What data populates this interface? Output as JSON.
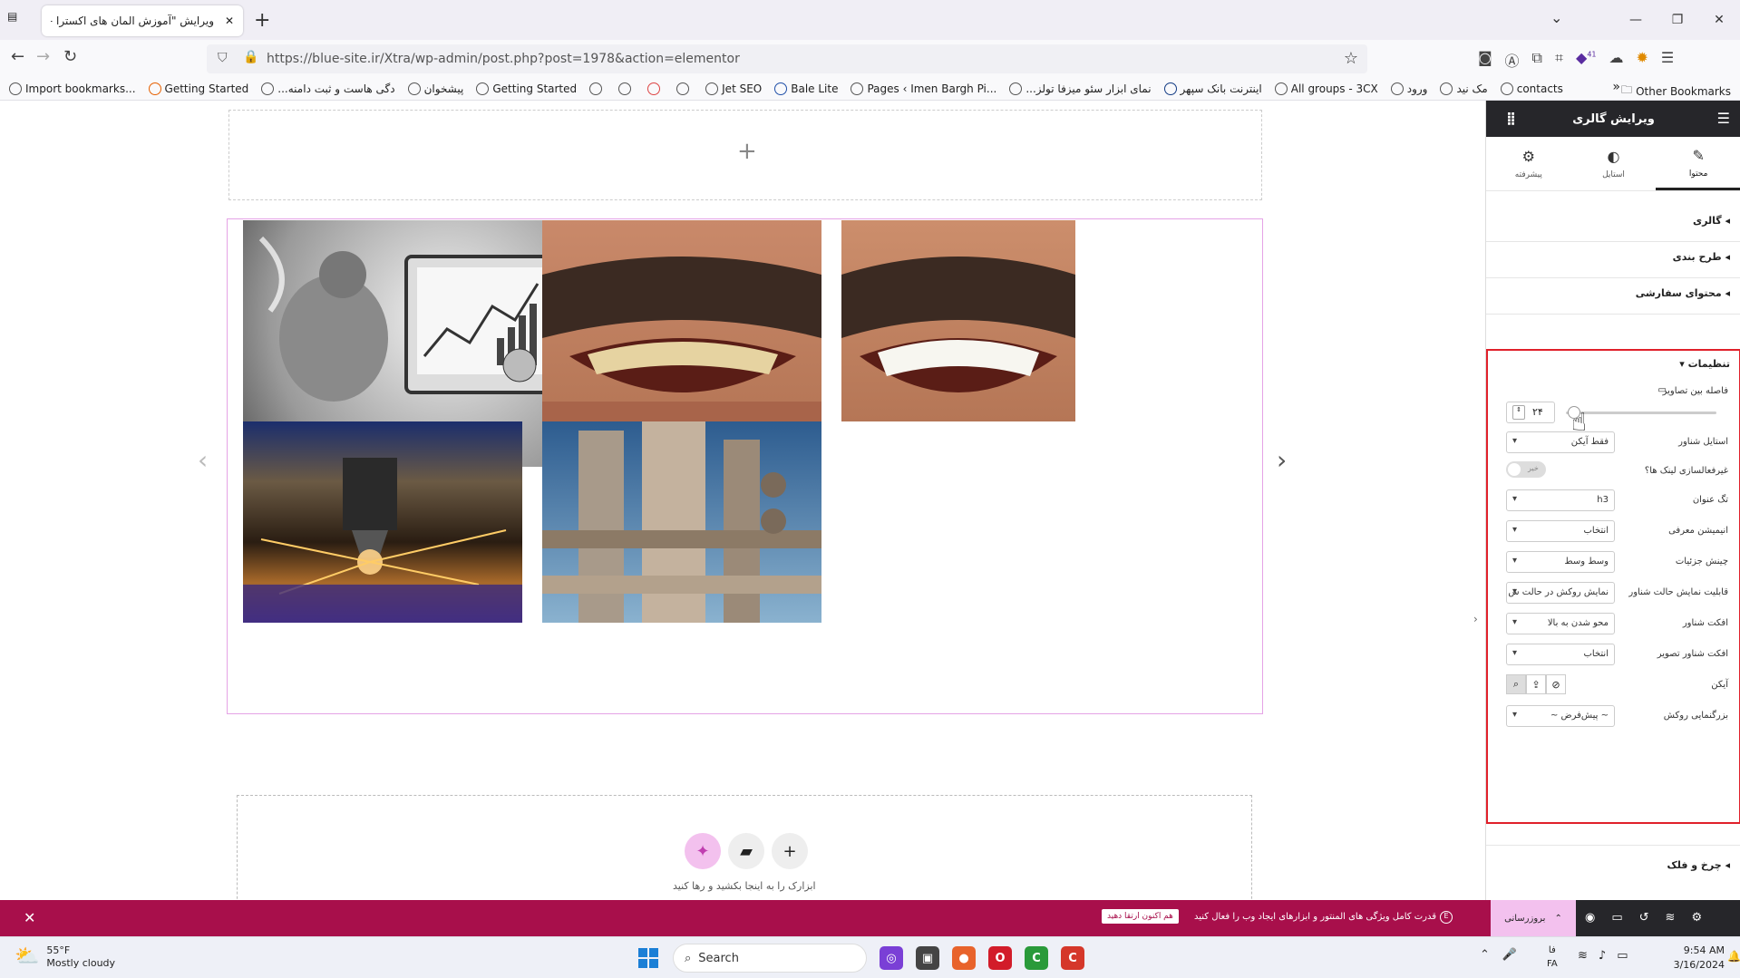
{
  "browser": {
    "tab_title": "ویرایش \"آموزش المان های اکسترا – ها",
    "url": "https://blue-site.ir/Xtra/wp-admin/post.php?post=1978&action=elementor",
    "url_host": "blue-site.ir",
    "notif_badge": "41",
    "bookmarks": [
      "Import bookmarks...",
      "Getting Started",
      "...دگی هاست و ثبت دامنه",
      "پیشخوان",
      "Getting Started",
      "Jet SEO",
      "Bale Lite",
      "Pages ‹ Imen Bargh Pi...",
      "...نمای ابزار سئو میزفا تولز",
      "اینترنت بانک سپهر",
      "All groups - 3CX",
      "ورود",
      "مک نید",
      "contacts"
    ],
    "other_bookmarks": "Other Bookmarks"
  },
  "canvas": {
    "drop_hint": "ابزارک را به اینجا بکشید و رها کنید"
  },
  "panel": {
    "header_title": "ویرایش گالری",
    "tabs": [
      {
        "label": "محتوا",
        "icon": "pencil-icon"
      },
      {
        "label": "استایل",
        "icon": "contrast-icon"
      },
      {
        "label": "پیشرفته",
        "icon": "gear-icon"
      }
    ],
    "sections": [
      "گالری",
      "طرح بندی",
      "محتوای سفارشی"
    ],
    "settings": {
      "title": "تنظیمات",
      "gap_label": "فاصله بین تصاویر",
      "gap_value": "۲۴",
      "overlay_style_label": "استایل شناور",
      "overlay_style_value": "فقط آیکن",
      "link_label": "غیرفعالسازی لینک ها؟",
      "link_toggle": "خیر",
      "title_tag_label": "تگ عنوان",
      "title_tag_value": "h3",
      "entrance_label": "انیمیشن معرفی",
      "entrance_value": "انتخاب",
      "details_label": "چینش جزئیات",
      "details_value": "وسط وسط",
      "overlay_display_label": "قابلیت نمایش حالت شناور",
      "overlay_display_value": "نمایش روکش در حالت ش",
      "overlay_effect_label": "افکت شناور",
      "overlay_effect_value": "محو شدن به بالا",
      "image_effect_label": "افکت شناور تصویر",
      "image_effect_value": "انتخاب",
      "icon_label": "آیکن",
      "lightbox_label": "بزرگنمایی روکش",
      "lightbox_value": "~ پیش‌فرض ~"
    },
    "last_section": "چرخ و فلک",
    "update_label": "بروزرسانی"
  },
  "notification": {
    "message": "قدرت کامل ویژگی های المنتور و ابزارهای ایجاد وب را فعال کنید",
    "button": "هم اکنون ارتقا دهید"
  },
  "taskbar": {
    "temperature": "55°F",
    "weather": "Mostly cloudy",
    "search": "Search",
    "time": "9:54 AM",
    "date": "3/16/2024",
    "lang_top": "فا",
    "lang_bottom": "FA"
  }
}
